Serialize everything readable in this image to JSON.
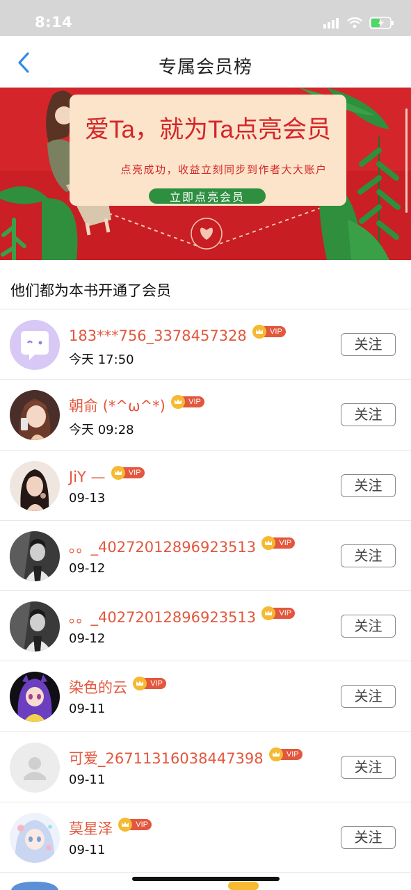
{
  "status_bar": {
    "time": "8:14"
  },
  "nav": {
    "title": "专属会员榜"
  },
  "banner": {
    "headline": "爱Ta，就为Ta点亮会员",
    "subtitle": "点亮成功，收益立刻同步到作者大大账户",
    "cta_label": "立即点亮会员"
  },
  "section": {
    "title": "他们都为本书开通了会员"
  },
  "members": [
    {
      "name": "183***756_3378457328",
      "time": "今天 17:50",
      "badge": "VIP",
      "follow_label": "关注",
      "avatar": "chat-bubble-avatar-icon"
    },
    {
      "name": "朝俞 (*^ω^*)",
      "time": "今天 09:28",
      "badge": "VIP",
      "follow_label": "关注",
      "avatar": "illustrated-girl-avatar"
    },
    {
      "name": "JiY —",
      "time": "09-13",
      "badge": "VIP",
      "follow_label": "关注",
      "avatar": "photo-girl-avatar"
    },
    {
      "name": "。。_40272012896923513",
      "time": "09-12",
      "badge": "VIP",
      "follow_label": "关注",
      "avatar": "grayscale-photo-avatar"
    },
    {
      "name": "。。_40272012896923513",
      "time": "09-12",
      "badge": "VIP",
      "follow_label": "关注",
      "avatar": "grayscale-photo-avatar"
    },
    {
      "name": "染色的云",
      "time": "09-11",
      "badge": "VIP",
      "follow_label": "关注",
      "avatar": "anime-purple-hair-avatar"
    },
    {
      "name": "可爱_26711316038447398",
      "time": "09-11",
      "badge": "VIP",
      "follow_label": "关注",
      "avatar": "default-person-avatar-icon"
    },
    {
      "name": "莫星泽",
      "time": "09-11",
      "badge": "VIP",
      "follow_label": "关注",
      "avatar": "anime-pastel-avatar"
    }
  ],
  "colors": {
    "accent_red": "#e2573d",
    "banner_red": "#d4252a",
    "banner_green": "#2d8f3f",
    "nav_blue": "#2f8ee6"
  }
}
